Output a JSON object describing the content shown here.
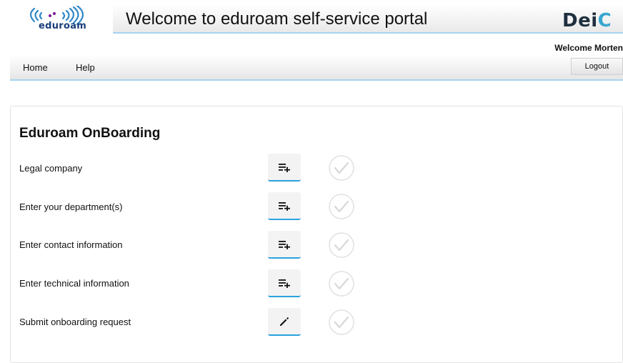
{
  "header": {
    "logo_text": "eduroam",
    "title": "Welcome to eduroam self-service portal",
    "brand": {
      "prefix": "Dei",
      "suffix": "C"
    }
  },
  "user": {
    "welcome": "Welcome Morten"
  },
  "nav": {
    "items": [
      {
        "label": "Home"
      },
      {
        "label": "Help"
      }
    ],
    "logout_label": "Logout"
  },
  "onboarding": {
    "title": "Eduroam OnBoarding",
    "steps": [
      {
        "label": "Legal company",
        "action_icon": "playlist-add-icon",
        "completed": false
      },
      {
        "label": "Enter your department(s)",
        "action_icon": "playlist-add-icon",
        "completed": false
      },
      {
        "label": "Enter contact information",
        "action_icon": "playlist-add-icon",
        "completed": false
      },
      {
        "label": "Enter technical information",
        "action_icon": "playlist-add-icon",
        "completed": false
      },
      {
        "label": "Submit onboarding request",
        "action_icon": "pencil-icon",
        "completed": false
      }
    ]
  },
  "colors": {
    "accent_underline": "#2aa2de",
    "header_border": "#a6d3ee",
    "logo_blue": "#1a3f7a",
    "check_inactive": "#d9d9d9"
  }
}
